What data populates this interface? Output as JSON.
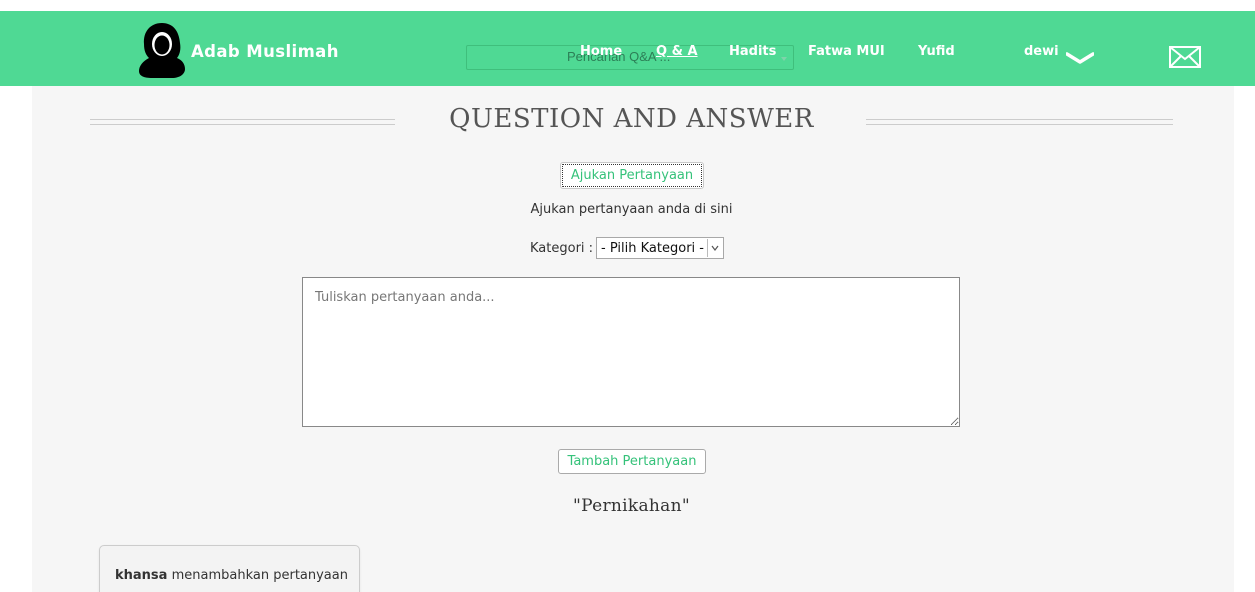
{
  "colors": {
    "navbar": "#4fd994",
    "accent_text": "#35c27a",
    "page_background": "#f6f6f6"
  },
  "navbar": {
    "logo_icon": "hijab-woman-icon",
    "brand": "Adab Muslimah",
    "search": {
      "placeholder": "Pencarian Q&A ..."
    },
    "items": [
      {
        "label": "Home"
      },
      {
        "label": "Q & A"
      },
      {
        "label": "Hadits"
      },
      {
        "label": "Fatwa MUI"
      },
      {
        "label": "Yufid"
      }
    ],
    "user": {
      "name": "dewi",
      "dropdown_icon": "chevron-down-icon"
    },
    "messages_icon": "envelope-icon"
  },
  "main": {
    "heading": "QUESTION AND ANSWER",
    "ask_button": "Ajukan Pertanyaan",
    "helper_text": "Ajukan pertanyaan anda di sini",
    "category_label": "Kategori :",
    "category_select": {
      "selected": "- Pilih Kategori -"
    },
    "question_placeholder": "Tuliskan pertanyaan anda...",
    "add_button": "Tambah Pertanyaan",
    "category_title": "\"Pernikahan\""
  },
  "activity": {
    "user": "khansa",
    "action": "menambahkan pertanyaan"
  }
}
